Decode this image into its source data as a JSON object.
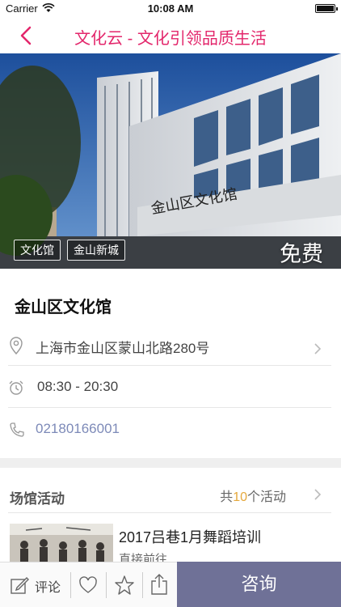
{
  "status_bar": {
    "carrier": "Carrier",
    "time": "10:08 AM"
  },
  "nav": {
    "title": "文化云 - 文化引领品质生活",
    "back_icon": "chevron-left-icon",
    "accent": "#e3266b"
  },
  "hero": {
    "tags": [
      "文化馆",
      "金山新城"
    ],
    "price": "免费",
    "sign_text": "金山区文化馆"
  },
  "venue": {
    "name": "金山区文化馆",
    "address": "上海市金山区蒙山北路280号",
    "hours": "08:30 - 20:30",
    "phone": "02180166001"
  },
  "activities": {
    "label": "场馆活动",
    "count_prefix": "共",
    "count": "10",
    "count_suffix": "个活动",
    "items": [
      {
        "title": "2017吕巷1月舞蹈培训",
        "subtitle": "直接前往"
      }
    ]
  },
  "bottom_bar": {
    "comment_label": "评论",
    "consult_label": "咨询",
    "consult_color": "#6f7197"
  }
}
